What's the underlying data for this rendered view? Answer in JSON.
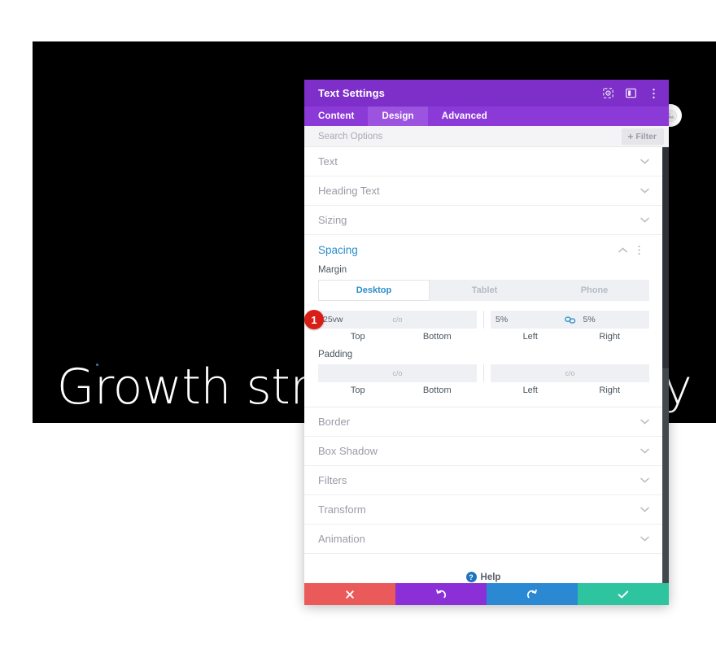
{
  "background": {
    "hero_heading": "Growth strategy for luxury",
    "float_button_icon": "image-placeholder-icon"
  },
  "modal": {
    "title": "Text Settings",
    "header_icons": [
      {
        "name": "target-icon"
      },
      {
        "name": "panel-layout-icon"
      },
      {
        "name": "more-vertical-icon"
      }
    ],
    "tabs": [
      {
        "label": "Content",
        "active": false
      },
      {
        "label": "Design",
        "active": true
      },
      {
        "label": "Advanced",
        "active": false
      }
    ],
    "search": {
      "placeholder": "Search Options",
      "value": ""
    },
    "filter_button": {
      "label": "Filter",
      "plus": "+"
    },
    "sections_above": [
      {
        "label": "Text"
      },
      {
        "label": "Heading Text"
      },
      {
        "label": "Sizing"
      }
    ],
    "spacing_section": {
      "title": "Spacing",
      "step_badge": "1",
      "margin": {
        "label": "Margin",
        "device_tabs": [
          {
            "label": "Desktop",
            "active": true
          },
          {
            "label": "Tablet",
            "active": false
          },
          {
            "label": "Phone",
            "active": false
          }
        ],
        "fields": [
          {
            "caption": "Top",
            "value": "25vw"
          },
          {
            "caption": "Bottom",
            "value": ""
          },
          {
            "caption": "Left",
            "value": "5%"
          },
          {
            "caption": "Right",
            "value": "5%"
          }
        ],
        "unit_glyph": "c/o",
        "link_icon": "link-chain-icon"
      },
      "padding": {
        "label": "Padding",
        "fields": [
          {
            "caption": "Top",
            "value": ""
          },
          {
            "caption": "Bottom",
            "value": ""
          },
          {
            "caption": "Left",
            "value": ""
          },
          {
            "caption": "Right",
            "value": ""
          }
        ],
        "unit_glyph": "c/o"
      }
    },
    "sections_below": [
      {
        "label": "Border"
      },
      {
        "label": "Box Shadow"
      },
      {
        "label": "Filters"
      },
      {
        "label": "Transform"
      },
      {
        "label": "Animation"
      }
    ],
    "help": {
      "label": "Help",
      "icon_char": "?"
    },
    "footer_buttons": [
      {
        "name": "cancel-button",
        "icon": "close-icon",
        "color": "#eb5a5a"
      },
      {
        "name": "undo-button",
        "icon": "undo-icon",
        "color": "#8b2fd6"
      },
      {
        "name": "redo-button",
        "icon": "redo-icon",
        "color": "#2b89d4"
      },
      {
        "name": "save-button",
        "icon": "check-icon",
        "color": "#2ec4a0"
      }
    ]
  },
  "colors": {
    "header_purple": "#7e2fc9",
    "tabbar_purple": "#8b3ad8",
    "active_tab_purple": "#9c54e0",
    "accent_blue": "#2c8ec9",
    "badge_red": "#d81e17"
  }
}
